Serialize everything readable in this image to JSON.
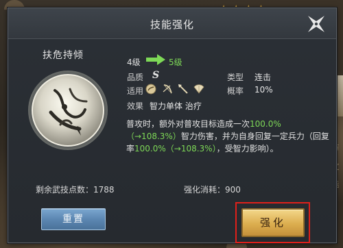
{
  "background": {
    "stars": "★★★★",
    "side_text": [
      "防",
      "攻",
      "魅"
    ]
  },
  "dialog": {
    "title": "技能强化",
    "close_icon": "close-x-icon"
  },
  "skill": {
    "name": "扶危持倾",
    "icon": "skill-orb-icon"
  },
  "level": {
    "from": "4级",
    "to": "5级",
    "arrow_color": "#7ed957"
  },
  "attributes": {
    "quality_label": "品质",
    "quality_value": "S",
    "type_label": "类型",
    "type_value": "连击",
    "applicable_label": "适用",
    "applicable_icons": [
      "orb-weapon-icon",
      "bow-icon",
      "spear-icon",
      "fan-icon"
    ],
    "rate_label": "概率",
    "rate_value": "10%",
    "effect_label": "效果",
    "effect_value": "智力单体 治疗"
  },
  "description": {
    "part1": "普攻时，额外对普攻目标造成一次",
    "val1": "100.0%（→108.3%）",
    "part2": "智力伤害，并为自身回复一定兵力（回复率",
    "val2": "100.0%（→108.3%）",
    "part3": "，受智力影响）。"
  },
  "footer": {
    "points_text": "剩余武技点数：1788",
    "cost_text": "强化消耗：900"
  },
  "buttons": {
    "reset_label": "重置",
    "enhance_label": "强化"
  },
  "colors": {
    "highlight_green": "#7ed957",
    "enhance_button_gold": "#dcae4f",
    "reset_button_blue": "#5c87b2",
    "selection_outline_red": "#e0201a"
  }
}
